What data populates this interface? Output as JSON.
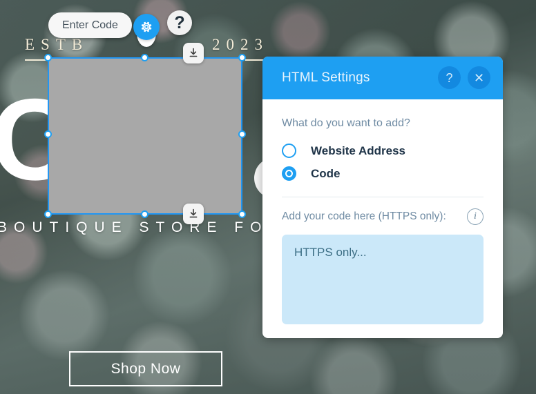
{
  "canvas": {
    "hero": {
      "letters": "CK",
      "estb_label": "ESTB",
      "year": "2023",
      "tagline": "BOUTIQUE STORE FOR P",
      "shop_button": "Shop Now"
    },
    "toolbar": {
      "enter_code_label": "Enter Code",
      "gear_icon": "gear-icon",
      "help_icon": "question-mark-icon"
    },
    "selection": {
      "download_icon": "download-icon",
      "handle_icon": "resize-handle"
    }
  },
  "panel": {
    "title": "HTML Settings",
    "help_label": "?",
    "close_label": "✕",
    "question_label": "What do you want to add?",
    "options": [
      {
        "label": "Website Address",
        "selected": false
      },
      {
        "label": "Code",
        "selected": true
      }
    ],
    "code_section_label": "Add your code here (HTTPS only):",
    "info_icon_label": "i",
    "code_placeholder": "HTTPS only...",
    "code_value": ""
  },
  "colors": {
    "accent": "#1e9ff2",
    "header_btn": "#1389e0",
    "textarea_bg": "#cbe8f9",
    "label": "#6f8ba3",
    "selection_fill": "#a8a8a8"
  }
}
